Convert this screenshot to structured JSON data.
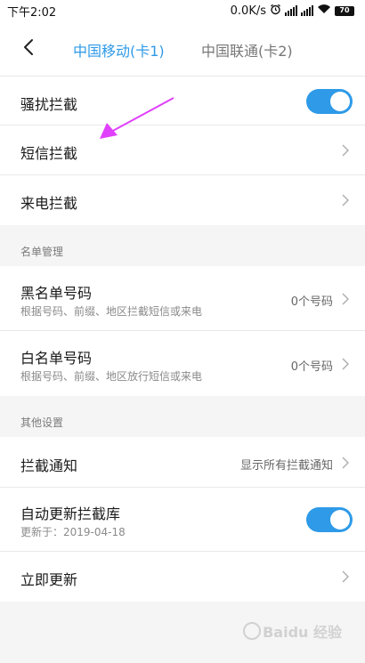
{
  "status_bar": {
    "time": "下午2:02",
    "speed": "0.0K/s",
    "battery": "70",
    "icons": [
      "alarm-icon",
      "signal-icon",
      "signal-icon",
      "wifi-icon",
      "battery-icon"
    ]
  },
  "header": {
    "back_icon": "chevron-left-icon",
    "tabs": [
      {
        "label": "中国移动(卡1)",
        "active": true
      },
      {
        "label": "中国联通(卡2)",
        "active": false
      }
    ],
    "accent_color": "#2e9ae8"
  },
  "rows": {
    "harassment": {
      "title": "骚扰拦截",
      "toggle": "on"
    },
    "sms": {
      "title": "短信拦截"
    },
    "call": {
      "title": "来电拦截"
    }
  },
  "list_section": {
    "label": "名单管理",
    "blacklist": {
      "title": "黑名单号码",
      "subtitle": "根据号码、前缀、地区拦截短信或来电",
      "value": "0个号码"
    },
    "whitelist": {
      "title": "白名单号码",
      "subtitle": "根据号码、前缀、地区放行短信或来电",
      "value": "0个号码"
    }
  },
  "other_section": {
    "label": "其他设置",
    "notify": {
      "title": "拦截通知",
      "value": "显示所有拦截通知"
    },
    "auto_update": {
      "title": "自动更新拦截库",
      "subtitle": "更新于：2019-04-18",
      "toggle": "on"
    },
    "update_now": {
      "title": "立即更新"
    }
  },
  "annotation": {
    "color": "#e040fb",
    "icon": "arrow-annotation"
  },
  "watermark": {
    "text": "Baidu 经验",
    "icon": "paw-icon"
  }
}
